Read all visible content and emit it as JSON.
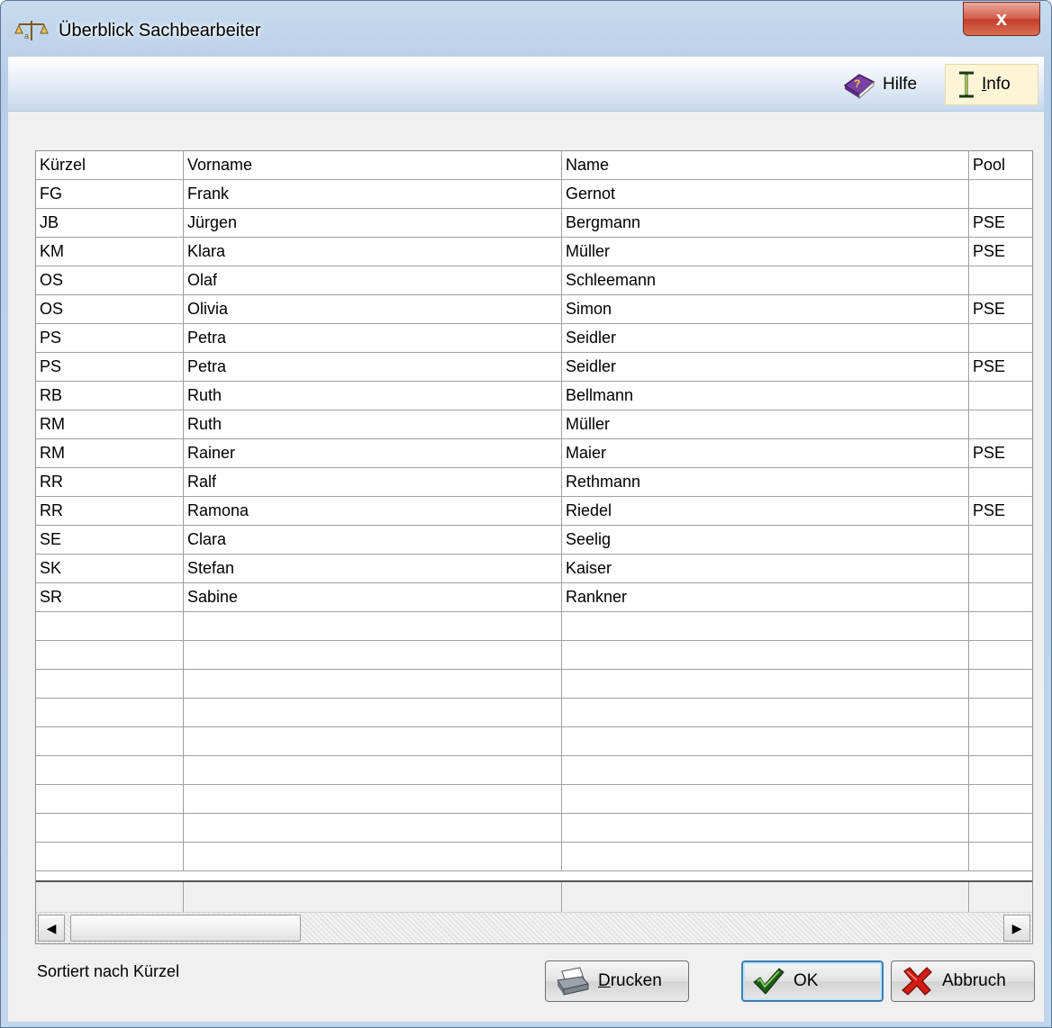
{
  "window": {
    "title": "Überblick Sachbearbeiter",
    "close_glyph": "x"
  },
  "menu": {
    "hilfe": "Hilfe",
    "info": "Info"
  },
  "table": {
    "columns": [
      "Kürzel",
      "Vorname",
      "Name",
      "Pool"
    ],
    "rows": [
      [
        "FG",
        "Frank",
        "Gernot",
        ""
      ],
      [
        "JB",
        "Jürgen",
        "Bergmann",
        "PSE"
      ],
      [
        "KM",
        "Klara",
        "Müller",
        "PSE"
      ],
      [
        "OS",
        "Olaf",
        "Schleemann",
        ""
      ],
      [
        "OS",
        "Olivia",
        "Simon",
        "PSE"
      ],
      [
        "PS",
        "Petra",
        "Seidler",
        ""
      ],
      [
        "PS",
        "Petra",
        "Seidler",
        "PSE"
      ],
      [
        "RB",
        "Ruth",
        "Bellmann",
        ""
      ],
      [
        "RM",
        "Ruth",
        "Müller",
        ""
      ],
      [
        "RM",
        "Rainer",
        "Maier",
        "PSE"
      ],
      [
        "RR",
        "Ralf",
        "Rethmann",
        ""
      ],
      [
        "RR",
        "Ramona",
        "Riedel",
        "PSE"
      ],
      [
        "SE",
        "Clara",
        "Seelig",
        ""
      ],
      [
        "SK",
        "Stefan",
        "Kaiser",
        ""
      ],
      [
        "SR",
        "Sabine",
        "Rankner",
        ""
      ]
    ]
  },
  "status": {
    "text": "Sortiert nach Kürzel"
  },
  "buttons": {
    "drucken": "Drucken",
    "ok": "OK",
    "abbruch": "Abbruch"
  },
  "icons": {
    "app": "scales-icon",
    "hilfe": "help-book-icon",
    "info": "info-cursor-icon",
    "drucken": "printer-icon",
    "ok": "checkmark-icon",
    "abbruch": "cancel-x-icon"
  }
}
